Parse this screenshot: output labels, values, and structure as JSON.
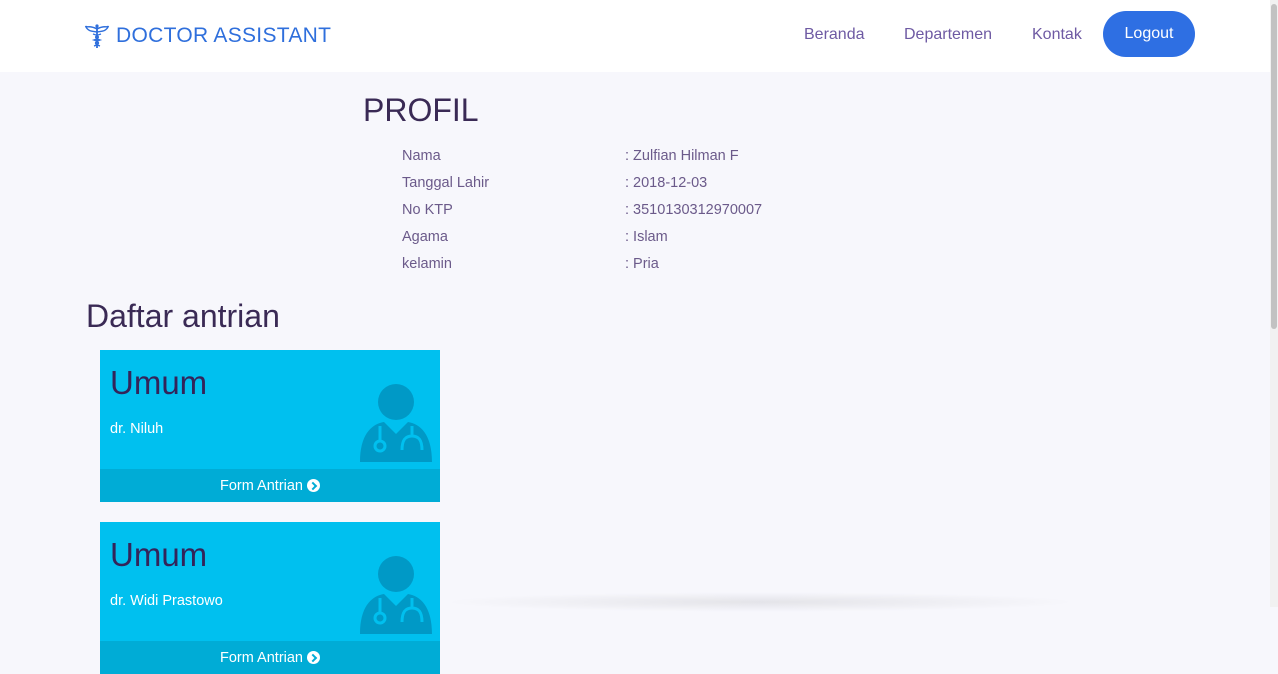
{
  "header": {
    "brand": "DOCTOR ASSISTANT",
    "brand_icon": "caduceus-icon",
    "nav": [
      {
        "label": "Beranda"
      },
      {
        "label": "Departemen"
      },
      {
        "label": "Kontak"
      }
    ],
    "logout_label": "Logout"
  },
  "profile": {
    "title": "PROFIL",
    "rows": [
      {
        "label": "Nama",
        "value": ": Zulfian Hilman F"
      },
      {
        "label": "Tanggal Lahir",
        "value": ": 2018-12-03"
      },
      {
        "label": "No KTP",
        "value": ": 3510130312970007"
      },
      {
        "label": "Agama",
        "value": ": Islam"
      },
      {
        "label": "kelamin",
        "value": ": Pria"
      }
    ]
  },
  "queue": {
    "title": "Daftar antrian",
    "cards": [
      {
        "department": "Umum",
        "doctor": "dr. Niluh",
        "footer": "Form Antrian",
        "icon": "user-md-icon"
      },
      {
        "department": "Umum",
        "doctor": "dr. Widi Prastowo",
        "footer": "Form Antrian",
        "icon": "user-md-icon"
      }
    ]
  },
  "colors": {
    "brand": "#2f6fdc",
    "card": "#00c0ef",
    "card_footer": "#00acd6",
    "logout": "#2e6fe3",
    "nav_text": "#6e5aa3",
    "heading": "#3a2a55"
  }
}
